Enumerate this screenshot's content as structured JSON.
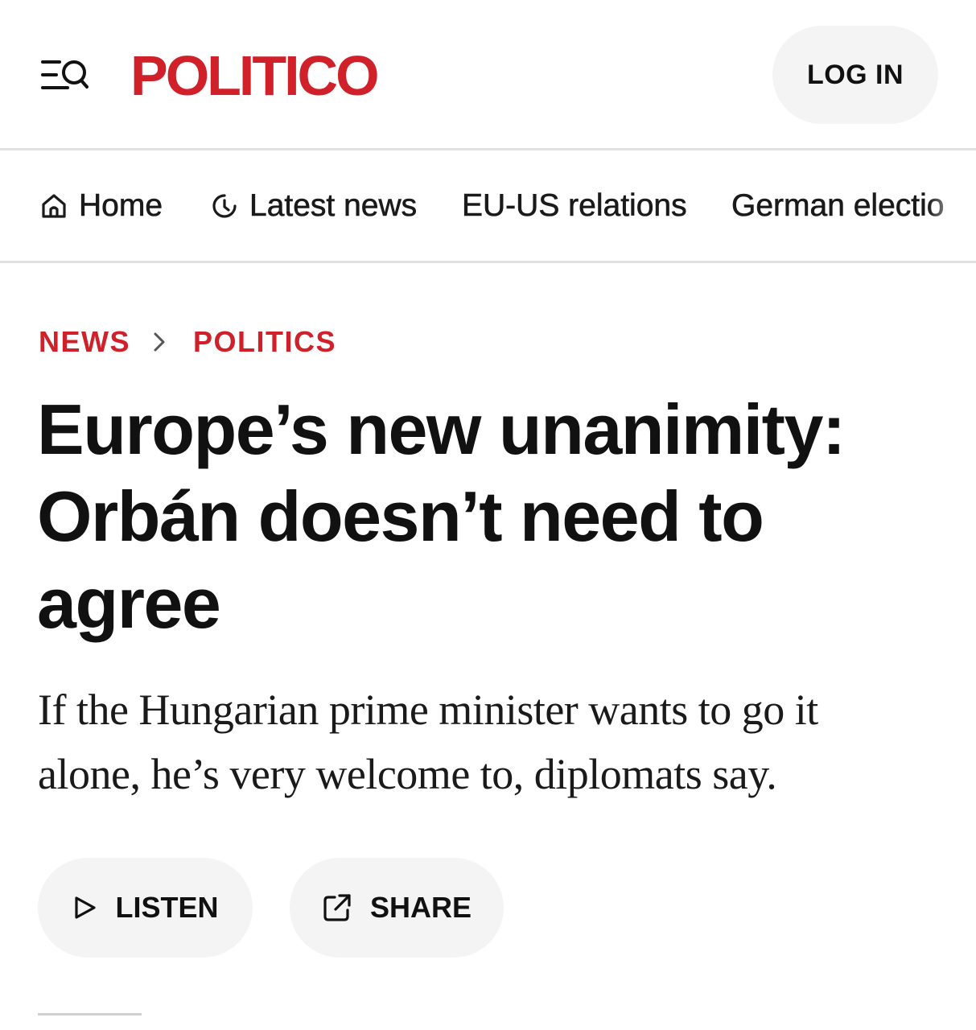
{
  "header": {
    "logo_text": "POLITICO",
    "login_label": "LOG IN",
    "menu_icon": "menu-search-icon",
    "brand_color": "#d0202a"
  },
  "nav": {
    "items": [
      {
        "label": "Home",
        "icon": "home-icon"
      },
      {
        "label": "Latest news",
        "icon": "clock-icon"
      },
      {
        "label": "EU-US relations"
      },
      {
        "label": "German electio"
      }
    ]
  },
  "article": {
    "breadcrumb": [
      "NEWS",
      "POLITICS"
    ],
    "headline": "Europe’s new unanimity: Orbán doesn’t need to agree",
    "dek": "If the Hungarian prime minister wants to go it alone, he’s very welcome to, diplomats say.",
    "actions": {
      "listen_label": "LISTEN",
      "listen_icon": "play-icon",
      "share_label": "SHARE",
      "share_icon": "external-link-icon"
    }
  }
}
